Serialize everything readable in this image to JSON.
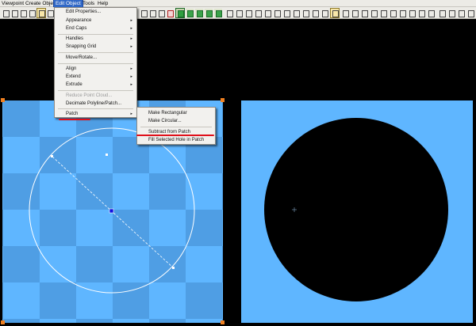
{
  "menubar": {
    "items": [
      "Viewpoint",
      "Create Object",
      "Edit Object",
      "Tools",
      "Help"
    ]
  },
  "edit_menu": {
    "items": [
      {
        "label": "Edit Properties...",
        "submenu": false,
        "disabled": false
      },
      {
        "label": "Appearance",
        "submenu": true,
        "disabled": false
      },
      {
        "label": "End Caps",
        "submenu": true,
        "disabled": false
      },
      {
        "label": "Handles",
        "submenu": true,
        "disabled": false
      },
      {
        "label": "Snapping Grid",
        "submenu": true,
        "disabled": false
      },
      {
        "label": "Move/Rotate...",
        "submenu": false,
        "disabled": false
      },
      {
        "label": "Align",
        "submenu": true,
        "disabled": false
      },
      {
        "label": "Extend",
        "submenu": true,
        "disabled": false
      },
      {
        "label": "Extrude",
        "submenu": true,
        "disabled": false
      },
      {
        "label": "Reduce Point Cloud...",
        "submenu": false,
        "disabled": true
      },
      {
        "label": "Decimate Polyline/Patch...",
        "submenu": false,
        "disabled": false
      },
      {
        "label": "Patch",
        "submenu": true,
        "disabled": false
      }
    ],
    "submenu_arrow": "▸"
  },
  "patch_submenu": {
    "items": [
      "Make Rectangular",
      "Make Circular...",
      "Subtract from Patch",
      "Fill Selected Hole in Patch"
    ]
  },
  "colors": {
    "menu_highlight": "#3168c6",
    "annotation_red": "#e0101a",
    "patch_light": "#5fb6ff",
    "patch_dark": "#4f9ee4",
    "handle_orange": "#f08020",
    "selection_blue": "#1010e0"
  },
  "icons": [
    "select-arrow-icon",
    "rectangle-select-icon",
    "lasso-icon",
    "rotate-view-icon",
    "zoom-icon",
    "pan-icon",
    "fit-view-icon",
    "view-mode-icon",
    "layer-icon",
    "light-icon"
  ]
}
